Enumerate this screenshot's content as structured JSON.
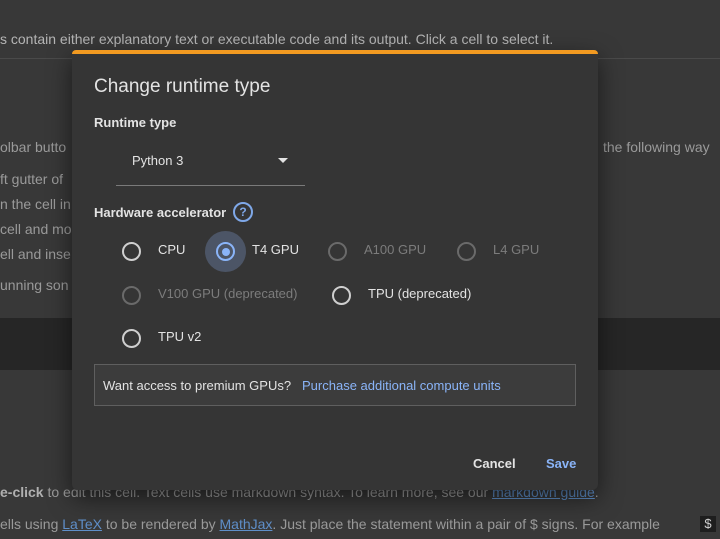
{
  "background": {
    "line1": "s contain either explanatory text or executable code and its output. Click a cell to select it.",
    "left_fragments": [
      "olbar butto",
      "ft gutter of",
      "n the cell in",
      "cell and mo",
      "ell and inse",
      "unning son"
    ],
    "right_fragment": "the following way",
    "bottom1_bold": "e-click",
    "bottom1_text": " to edit this cell. Text cells use markdown syntax. To learn more, see our ",
    "bottom1_link": "markdown guide",
    "bottom1_end": ".",
    "bottom2_pre": "ells using ",
    "bottom2_link1": "LaTeX",
    "bottom2_mid": " to be rendered by ",
    "bottom2_link2": "MathJax",
    "bottom2_text": ". Just place the statement within a pair of $ signs. For example",
    "dollar_chip": "$"
  },
  "dialog": {
    "title": "Change runtime type",
    "runtime_label": "Runtime type",
    "runtime_value": "Python 3",
    "hw_label": "Hardware accelerator",
    "help_glyph": "?",
    "options": [
      {
        "label": "CPU",
        "checked": false,
        "disabled": false
      },
      {
        "label": "T4 GPU",
        "checked": true,
        "disabled": false
      },
      {
        "label": "A100 GPU",
        "checked": false,
        "disabled": true
      },
      {
        "label": "L4 GPU",
        "checked": false,
        "disabled": true
      },
      {
        "label": "V100 GPU (deprecated)",
        "checked": false,
        "disabled": true
      },
      {
        "label": "TPU (deprecated)",
        "checked": false,
        "disabled": false
      },
      {
        "label": "TPU v2",
        "checked": false,
        "disabled": false
      }
    ],
    "premium_text": "Want access to premium GPUs?",
    "premium_link": "Purchase additional compute units",
    "cancel": "Cancel",
    "save": "Save"
  },
  "colors": {
    "accent": "#f29a21",
    "link": "#8ab4f8",
    "dialog_bg": "#353535"
  }
}
